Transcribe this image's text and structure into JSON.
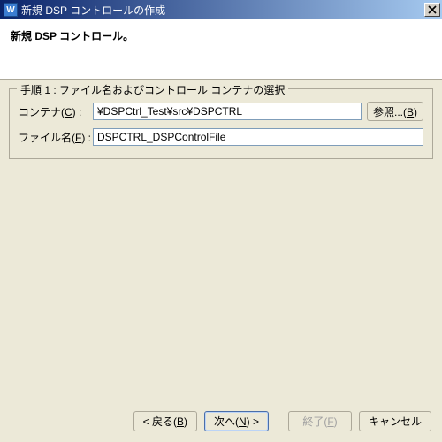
{
  "titlebar": {
    "icon_letter": "W",
    "title": "新規 DSP コントロールの作成"
  },
  "header": {
    "title": "新規 DSP コントロール。"
  },
  "step1": {
    "legend": "手順 1 : ファイル名およびコントロール コンテナの選択",
    "container_label_pre": "コンテナ(",
    "container_accel": "C",
    "container_label_post": ") :",
    "container_value": "¥DSPCtrl_Test¥src¥DSPCTRL",
    "browse_label_pre": "参照...(",
    "browse_accel": "B",
    "browse_label_post": ")",
    "filename_label_pre": "ファイル名(",
    "filename_accel": "F",
    "filename_label_post": ") :",
    "filename_value": "DSPCTRL_DSPControlFile"
  },
  "buttons": {
    "back_pre": "< 戻る(",
    "back_accel": "B",
    "back_post": ")",
    "next_pre": "次へ(",
    "next_accel": "N",
    "next_post": ") >",
    "finish_pre": "終了(",
    "finish_accel": "F",
    "finish_post": ")",
    "cancel": "キャンセル"
  }
}
